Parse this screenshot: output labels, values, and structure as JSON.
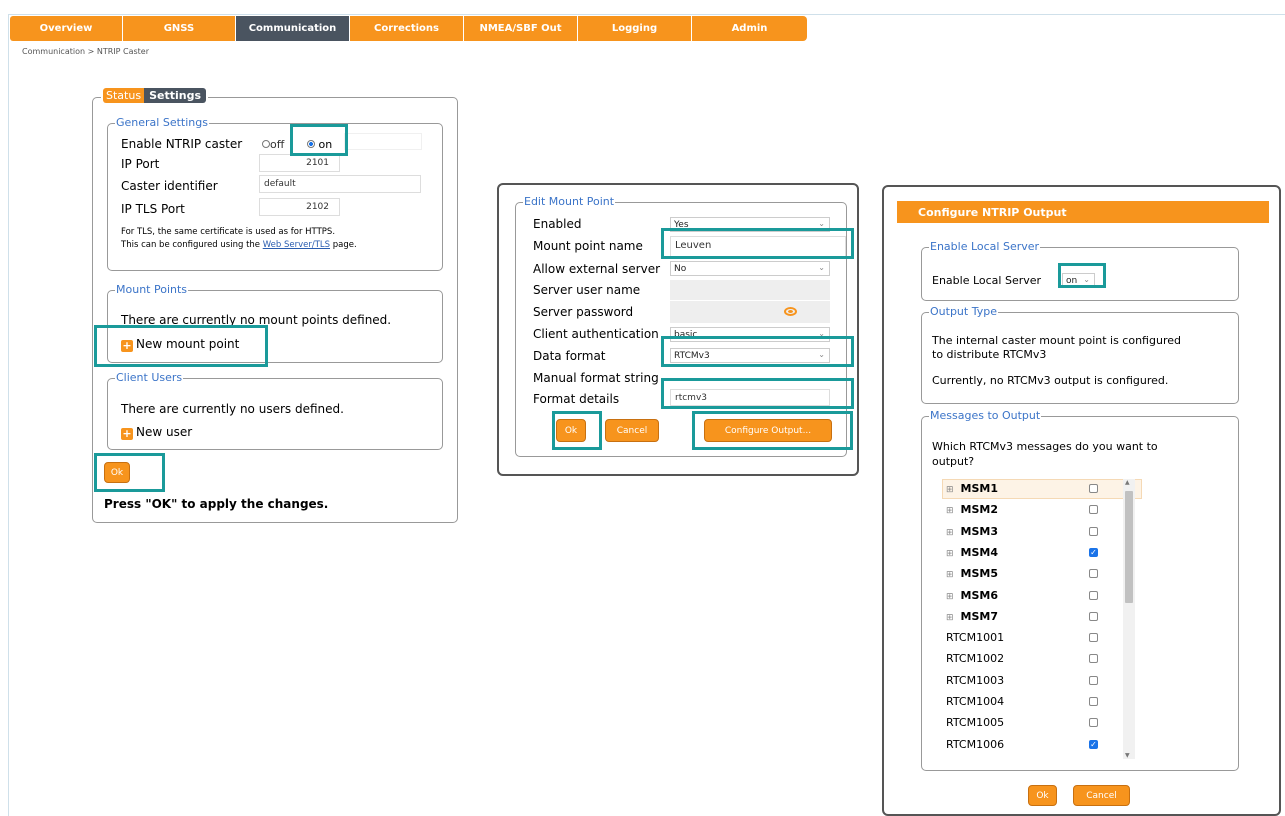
{
  "nav": {
    "tabs": [
      "Overview",
      "GNSS",
      "Communication",
      "Corrections",
      "NMEA/SBF Out",
      "Logging",
      "Admin"
    ],
    "active_index": 2
  },
  "breadcrumb": "Communication > NTRIP Caster",
  "caster_panel": {
    "tab_status": "Status",
    "tab_settings": "Settings",
    "general": {
      "legend": "General Settings",
      "enable_label": "Enable NTRIP caster",
      "enable_off": "off",
      "enable_on": "on",
      "ip_port_label": "IP Port",
      "ip_port_value": "2101",
      "caster_id_label": "Caster identifier",
      "caster_id_value": "default",
      "tls_port_label": "IP TLS Port",
      "tls_port_value": "2102",
      "tls_note_1": "For TLS, the same certificate is used as for HTTPS.",
      "tls_note_2_prefix": "This can be configured using the ",
      "tls_note_link": "Web Server/TLS",
      "tls_note_2_suffix": " page."
    },
    "mount_points": {
      "legend": "Mount Points",
      "empty_text": "There are currently no mount points defined.",
      "new_label": "New mount point"
    },
    "client_users": {
      "legend": "Client Users",
      "empty_text": "There are currently no users defined.",
      "new_label": "New user"
    },
    "ok_label": "Ok",
    "apply_note": "Press \"OK\" to apply the changes."
  },
  "edit_mount": {
    "legend": "Edit Mount Point",
    "enabled_label": "Enabled",
    "enabled_value": "Yes",
    "name_label": "Mount point name",
    "name_value": "Leuven",
    "ext_label": "Allow external server",
    "ext_value": "No",
    "user_label": "Server user name",
    "pass_label": "Server password",
    "auth_label": "Client authentication",
    "auth_value": "basic",
    "format_label": "Data format",
    "format_value": "RTCMv3",
    "manual_label": "Manual format string",
    "details_label": "Format details",
    "details_value": "rtcmv3",
    "ok_label": "Ok",
    "cancel_label": "Cancel",
    "configure_label": "Configure Output..."
  },
  "output_dialog": {
    "title": "Configure NTRIP Output",
    "local_legend": "Enable Local Server",
    "local_label": "Enable Local Server",
    "local_value": "on",
    "type_legend": "Output Type",
    "type_text_1": "The internal caster mount point is configured",
    "type_text_2": "to distribute RTCMv3",
    "type_text_3": "Currently, no RTCMv3 output is configured.",
    "messages_legend": "Messages to Output",
    "messages_q1": "Which RTCMv3 messages do you want to",
    "messages_q2": "output?",
    "messages": [
      {
        "name": "MSM1",
        "group": true,
        "checked": false
      },
      {
        "name": "MSM2",
        "group": true,
        "checked": false
      },
      {
        "name": "MSM3",
        "group": true,
        "checked": false
      },
      {
        "name": "MSM4",
        "group": true,
        "checked": true
      },
      {
        "name": "MSM5",
        "group": true,
        "checked": false
      },
      {
        "name": "MSM6",
        "group": true,
        "checked": false
      },
      {
        "name": "MSM7",
        "group": true,
        "checked": false
      },
      {
        "name": "RTCM1001",
        "group": false,
        "checked": false
      },
      {
        "name": "RTCM1002",
        "group": false,
        "checked": false
      },
      {
        "name": "RTCM1003",
        "group": false,
        "checked": false
      },
      {
        "name": "RTCM1004",
        "group": false,
        "checked": false
      },
      {
        "name": "RTCM1005",
        "group": false,
        "checked": false
      },
      {
        "name": "RTCM1006",
        "group": false,
        "checked": true
      }
    ],
    "ok_label": "Ok",
    "cancel_label": "Cancel"
  },
  "colors": {
    "accent": "#f7941d",
    "active_tab": "#4a5460",
    "highlight": "#1a9a9a",
    "legend": "#3b74c8"
  }
}
